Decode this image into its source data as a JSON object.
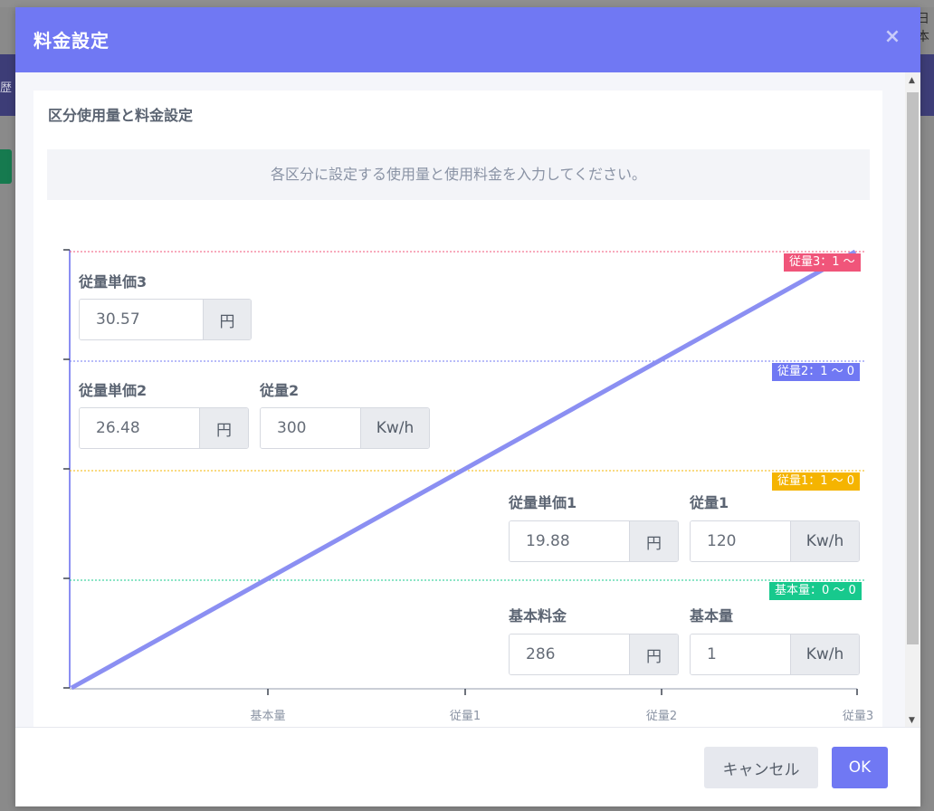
{
  "background": {
    "left_text": "歴",
    "right_text": "日本"
  },
  "modal": {
    "title": "料金設定",
    "close_glyph": "×"
  },
  "card": {
    "title": "区分使用量と料金設定",
    "info": "各区分に設定する使用量と使用料金を入力してください。"
  },
  "levels": [
    {
      "label": "従量3：1 〜",
      "color": "#f0557a"
    },
    {
      "label": "従量2：1 〜 0",
      "color": "#7078f3"
    },
    {
      "label": "従量1：1 〜 0",
      "color": "#f5b400"
    },
    {
      "label": "基本量：0 〜 0",
      "color": "#17c98d"
    }
  ],
  "x_axis_labels": [
    "基本量",
    "従量1",
    "従量2",
    "従量3"
  ],
  "line_color": "#8b8ff2",
  "fields": {
    "unit_price_3": {
      "label": "従量単価3",
      "value": "30.57",
      "unit": "円"
    },
    "unit_price_2": {
      "label": "従量単価2",
      "value": "26.48",
      "unit": "円"
    },
    "usage_2": {
      "label": "従量2",
      "value": "300",
      "unit": "Kw/h"
    },
    "unit_price_1": {
      "label": "従量単価1",
      "value": "19.88",
      "unit": "円"
    },
    "usage_1": {
      "label": "従量1",
      "value": "120",
      "unit": "Kw/h"
    },
    "base_fee": {
      "label": "基本料金",
      "value": "286",
      "unit": "円"
    },
    "base_usage": {
      "label": "基本量",
      "value": "1",
      "unit": "Kw/h"
    }
  },
  "footer": {
    "cancel_label": "キャンセル",
    "ok_label": "OK"
  }
}
